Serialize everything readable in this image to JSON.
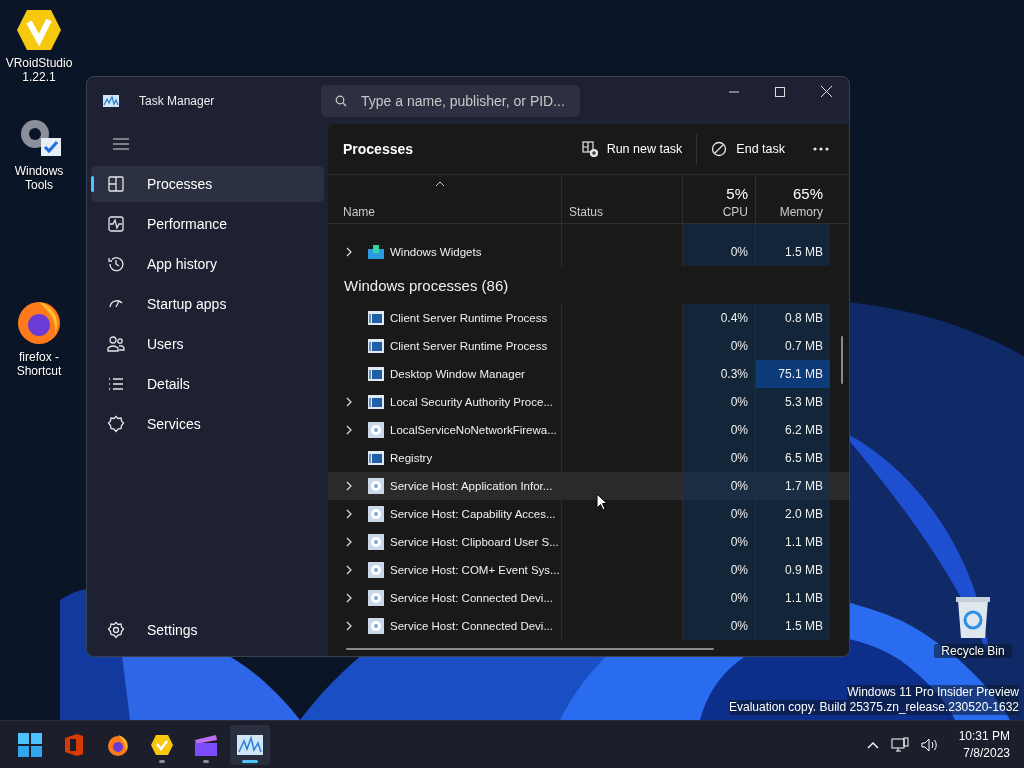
{
  "desktop_icons": [
    {
      "label": "VRoidStudio 1.22.1",
      "kind": "vroid"
    },
    {
      "label": "Windows Tools",
      "kind": "tools"
    },
    {
      "label": "firefox - Shortcut",
      "kind": "firefox"
    },
    {
      "label": "Recycle Bin",
      "kind": "recycle"
    }
  ],
  "window": {
    "title": "Task Manager",
    "search": {
      "placeholder": "Type a name, publisher, or PID..."
    }
  },
  "sidebar": {
    "items": [
      {
        "label": "Processes",
        "kind": "processes",
        "selected": true
      },
      {
        "label": "Performance",
        "kind": "performance",
        "selected": false
      },
      {
        "label": "App history",
        "kind": "history",
        "selected": false
      },
      {
        "label": "Startup apps",
        "kind": "startup",
        "selected": false
      },
      {
        "label": "Users",
        "kind": "users",
        "selected": false
      },
      {
        "label": "Details",
        "kind": "details",
        "selected": false
      },
      {
        "label": "Services",
        "kind": "services",
        "selected": false
      }
    ],
    "settings": "Settings"
  },
  "page": {
    "title": "Processes",
    "actions": [
      "Run new task",
      "End task"
    ]
  },
  "table": {
    "columns": [
      {
        "label": "Name",
        "sorted": true
      },
      {
        "label": "Status"
      },
      {
        "label": "CPU",
        "total": "5%"
      },
      {
        "label": "Memory",
        "total": "65%"
      }
    ],
    "rows": [
      {
        "kind": "widgets",
        "name": "Windows Widgets",
        "expandable": true,
        "cpu": "0%",
        "memory": "1.5 MB",
        "memory_high": false,
        "hovered": false
      },
      {
        "kind": "group",
        "label": "Windows processes (86)"
      },
      {
        "kind": "window",
        "name": "Client Server Runtime Process",
        "expandable": false,
        "cpu": "0.4%",
        "memory": "0.8 MB",
        "memory_high": false,
        "hovered": false
      },
      {
        "kind": "window",
        "name": "Client Server Runtime Process",
        "expandable": false,
        "cpu": "0%",
        "memory": "0.7 MB",
        "memory_high": false,
        "hovered": false
      },
      {
        "kind": "window",
        "name": "Desktop Window Manager",
        "expandable": false,
        "cpu": "0.3%",
        "memory": "75.1 MB",
        "memory_high": true,
        "hovered": false
      },
      {
        "kind": "window",
        "name": "Local Security Authority Proce...",
        "expandable": true,
        "cpu": "0%",
        "memory": "5.3 MB",
        "memory_high": false,
        "hovered": false
      },
      {
        "kind": "gear",
        "name": "LocalServiceNoNetworkFirewa...",
        "expandable": true,
        "cpu": "0%",
        "memory": "6.2 MB",
        "memory_high": false,
        "hovered": false
      },
      {
        "kind": "window",
        "name": "Registry",
        "expandable": false,
        "cpu": "0%",
        "memory": "6.5 MB",
        "memory_high": false,
        "hovered": false
      },
      {
        "kind": "gear",
        "name": "Service Host: Application Infor...",
        "expandable": true,
        "cpu": "0%",
        "memory": "1.7 MB",
        "memory_high": false,
        "hovered": true
      },
      {
        "kind": "gear",
        "name": "Service Host: Capability Acces...",
        "expandable": true,
        "cpu": "0%",
        "memory": "2.0 MB",
        "memory_high": false,
        "hovered": false
      },
      {
        "kind": "gear",
        "name": "Service Host: Clipboard User S...",
        "expandable": true,
        "cpu": "0%",
        "memory": "1.1 MB",
        "memory_high": false,
        "hovered": false
      },
      {
        "kind": "gear",
        "name": "Service Host: COM+ Event Sys...",
        "expandable": true,
        "cpu": "0%",
        "memory": "0.9 MB",
        "memory_high": false,
        "hovered": false
      },
      {
        "kind": "gear",
        "name": "Service Host: Connected Devi...",
        "expandable": true,
        "cpu": "0%",
        "memory": "1.1 MB",
        "memory_high": false,
        "hovered": false
      },
      {
        "kind": "gear",
        "name": "Service Host: Connected Devi...",
        "expandable": true,
        "cpu": "0%",
        "memory": "1.5 MB",
        "memory_high": false,
        "hovered": false
      }
    ]
  },
  "watermark_notice": [
    "Windows 11 Pro Insider Preview",
    "Evaluation copy. Build 25375.zn_release.230520-1632"
  ],
  "taskbar": {
    "apps": [
      {
        "kind": "start",
        "selected": false,
        "running": false
      },
      {
        "kind": "office",
        "selected": false,
        "running": false
      },
      {
        "kind": "firefox",
        "selected": false,
        "running": false
      },
      {
        "kind": "vroid",
        "selected": false,
        "running": true
      },
      {
        "kind": "clipchamp",
        "selected": false,
        "running": true
      },
      {
        "kind": "taskmanager",
        "selected": true,
        "running": true
      }
    ],
    "time": "10:31 PM",
    "date": "7/8/2023"
  }
}
